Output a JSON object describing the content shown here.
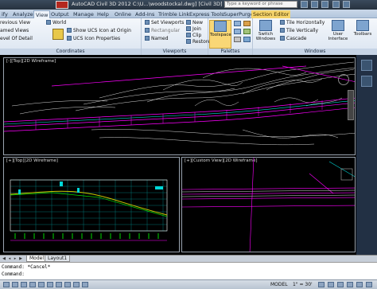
{
  "titlebar": {
    "title": "AutoCAD Civil 3D 2012   C:\\U...\\woodstockal.dwg] [Civil 3D]",
    "search_placeholder": "Type a keyword or phrase"
  },
  "ribbon_tabs": [
    {
      "label": "ify",
      "active": false
    },
    {
      "label": "Analyze",
      "active": false
    },
    {
      "label": "View",
      "active": true
    },
    {
      "label": "Output",
      "active": false
    },
    {
      "label": "Manage",
      "active": false
    },
    {
      "label": "Help",
      "active": false
    },
    {
      "label": "Online",
      "active": false
    },
    {
      "label": "Add-Ins",
      "active": false
    },
    {
      "label": "Trimble Link",
      "active": false
    },
    {
      "label": "Express Tools",
      "active": false
    },
    {
      "label": "SuperPurge",
      "active": false
    },
    {
      "label": "Section Editor",
      "active": false,
      "context": true
    }
  ],
  "ribbon": {
    "coordinates": {
      "label": "Coordinates",
      "left_items": [
        "revious View",
        "amed Views",
        "evel Of Detail"
      ],
      "ucs_items": [
        "World",
        "Show UCS Icon at Origin",
        "UCS Icon Properties"
      ]
    },
    "viewports": {
      "label": "Viewports",
      "items": [
        "Set Viewports",
        "Rectangular",
        "Named"
      ],
      "small_items": [
        "New",
        "Join",
        "Clip",
        "Restore"
      ]
    },
    "palettes": {
      "label": "Palettes",
      "toolspace_label": "Toolspace"
    },
    "windows": {
      "label": "Windows",
      "switch_label": "Switch Windows",
      "items": [
        "Tile Horizontally",
        "Tile Vertically",
        "Cascade"
      ],
      "ui_label": "User Interface",
      "toolbars_label": "Toolbars"
    }
  },
  "viewports": {
    "main_label": "[-][Top][2D Wireframe]",
    "left_label": "[+][Top][2D Wireframe]",
    "right_label": "[+][Custom View][2D Wireframe]"
  },
  "layout_tabs": [
    {
      "label": "Model",
      "active": true
    },
    {
      "label": "Layout1",
      "active": false
    }
  ],
  "command": {
    "line1": "Command: *Cancel*",
    "line2": "Command:"
  },
  "status": {
    "model": "MODEL",
    "scale": "1\" = 30'"
  },
  "colors": {
    "contour": "#d8d8d8",
    "alignment": "#ff00ff",
    "profile": "#c8c800",
    "cyan": "#00d8d8",
    "grid": "#008a8a"
  }
}
